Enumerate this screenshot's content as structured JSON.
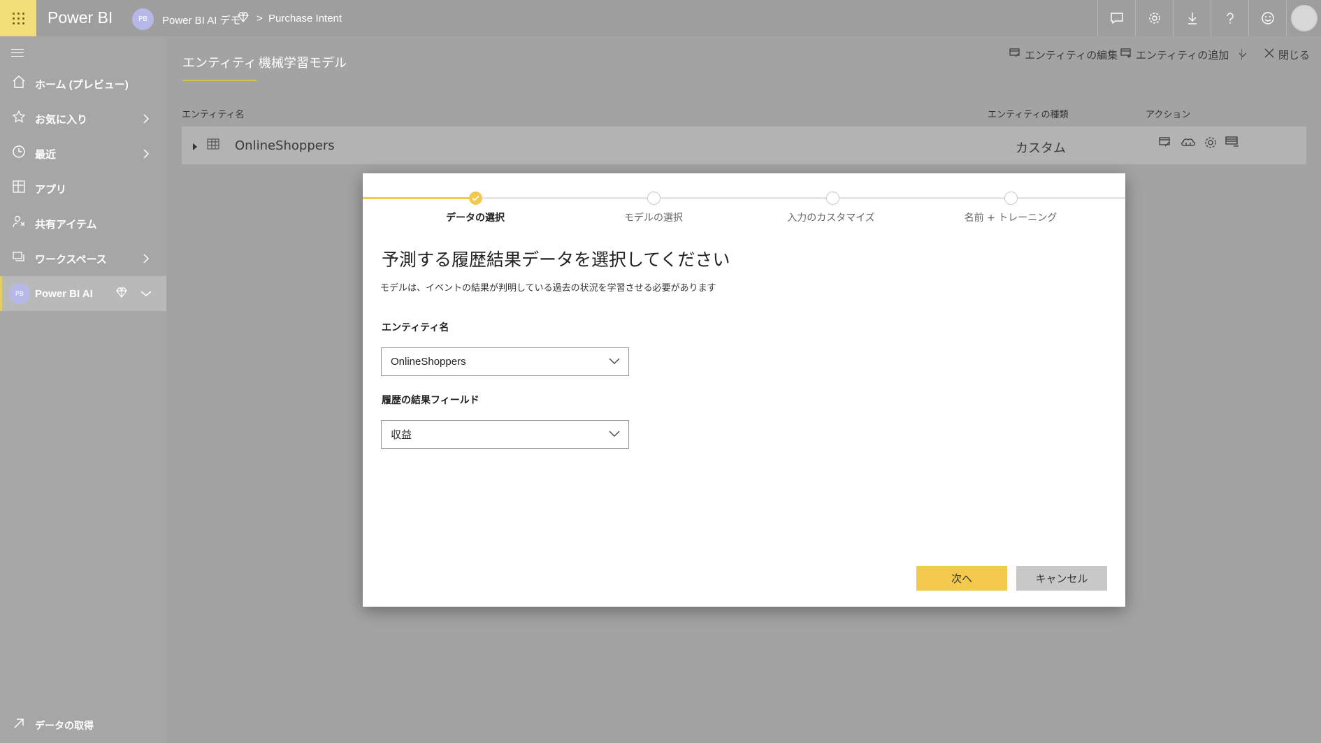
{
  "app": {
    "brand": "Power BI",
    "workspace_avatar": "PB",
    "breadcrumb": {
      "workspace": "Power BI AI デモ",
      "separator": ">",
      "item": "Purchase Intent"
    }
  },
  "topbar_icons": [
    "chat-icon",
    "gear-icon",
    "download-icon",
    "help-icon",
    "smiley-icon",
    "user-avatar"
  ],
  "sidebar": {
    "items": [
      {
        "label": "ホーム (プレビュー)",
        "icon": "home-icon",
        "chevron": ""
      },
      {
        "label": "お気に入り",
        "icon": "star-icon",
        "chevron": "right"
      },
      {
        "label": "最近",
        "icon": "clock-icon",
        "chevron": "right"
      },
      {
        "label": "アプリ",
        "icon": "apps-icon",
        "chevron": ""
      },
      {
        "label": "共有アイテム",
        "icon": "shared-icon",
        "chevron": ""
      },
      {
        "label": "ワークスペース",
        "icon": "workspace-icon",
        "chevron": "right"
      }
    ],
    "workspace": {
      "avatar": "PB",
      "label": "Power BI AI",
      "icon": "diamond-icon"
    },
    "get_data": "データの取得"
  },
  "main": {
    "tabs": [
      "エンティティ",
      "機械学習モデル"
    ],
    "commands": {
      "edit": "エンティティの編集",
      "add": "エンティティの追加",
      "close": "閉じる"
    },
    "columns": {
      "name": "エンティティ名",
      "type": "エンティティの種類",
      "actions": "アクション"
    },
    "row": {
      "name": "OnlineShoppers",
      "type": "カスタム"
    }
  },
  "dialog": {
    "steps": [
      "データの選択",
      "モデルの選択",
      "入力のカスタマイズ",
      "名前 + トレーニング"
    ],
    "current_step": 1,
    "title": "予測する履歴結果データを選択してください",
    "subtitle": "モデルは、イベントの結果が判明している過去の状況を学習させる必要があります",
    "entity_label": "エンティティ名",
    "entity_value": "OnlineShoppers",
    "outcome_label": "履歴の結果フィールド",
    "outcome_value": "収益",
    "next_button": "次へ",
    "cancel_button": "キャンセル"
  },
  "colors": {
    "accent": "#f2c94c",
    "overlay": "#a3a3a3"
  }
}
